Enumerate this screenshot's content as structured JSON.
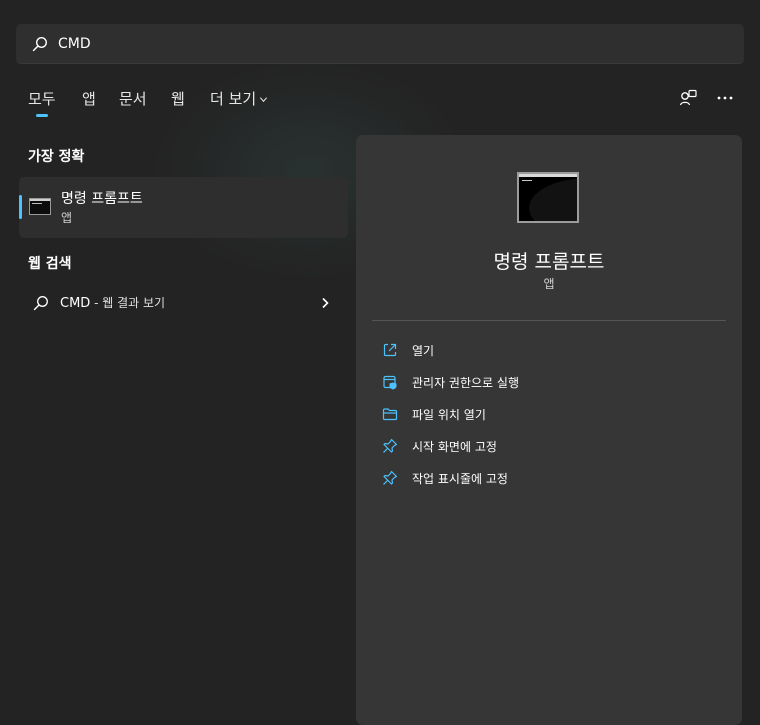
{
  "search": {
    "value": "CMD"
  },
  "tabs": [
    {
      "label": "모두",
      "active": true
    },
    {
      "label": "앱"
    },
    {
      "label": "문서"
    },
    {
      "label": "웹"
    },
    {
      "label": "더 보기"
    }
  ],
  "top_icons": [
    "account-switch-icon",
    "more-options-icon"
  ],
  "best_match": {
    "section_title": "가장 정확",
    "title": "명령 프롬프트",
    "subtitle": "앱",
    "icon": "cmd-app-icon"
  },
  "web_search": {
    "section_title": "웹 검색",
    "query": "CMD",
    "suffix": " - 웹 결과 보기",
    "icon": "search-icon"
  },
  "detail": {
    "title": "명령 프롬프트",
    "subtitle": "앱",
    "actions": [
      {
        "label": "열기",
        "icon": "open-external-icon"
      },
      {
        "label": "관리자 권한으로 실행",
        "icon": "shield-admin-icon"
      },
      {
        "label": "파일 위치 열기",
        "icon": "folder-icon"
      },
      {
        "label": "시작 화면에 고정",
        "icon": "pin-icon"
      },
      {
        "label": "작업 표시줄에 고정",
        "icon": "pin-icon"
      }
    ]
  },
  "colors": {
    "accent": "#4cc2ff",
    "background": "#232323",
    "panel": "#363636"
  }
}
